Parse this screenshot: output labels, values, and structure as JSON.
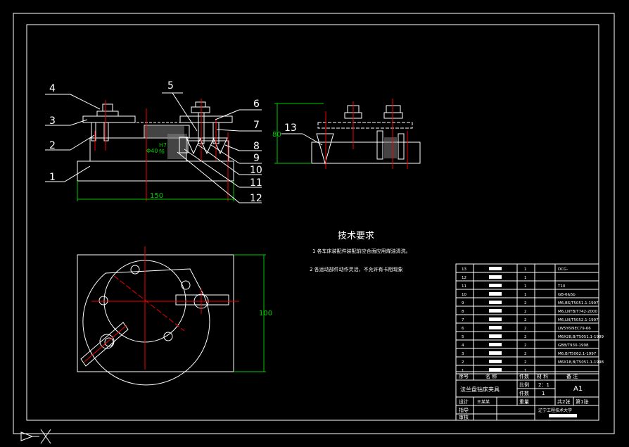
{
  "labels": {
    "view1": [
      "1",
      "2",
      "3",
      "4",
      "5",
      "6",
      "7",
      "8",
      "9",
      "10",
      "11",
      "12"
    ],
    "view2": "13"
  },
  "dims": {
    "width": "150",
    "height_side": "80",
    "height_top": "100",
    "fit_tol": "H7",
    "fit_dia": "Φ40",
    "fit_tol2": "f6"
  },
  "tech": {
    "title": "技术要求",
    "items": [
      "1  各车床装配件装配前应合面应用煤油清洗。",
      "2  各运动部件动作灵活，不允许有卡阻现象"
    ]
  },
  "bom": {
    "rows": [
      {
        "no": "13",
        "qty": "1",
        "std": "DCG-"
      },
      {
        "no": "12",
        "qty": "1",
        "std": ""
      },
      {
        "no": "11",
        "qty": "1",
        "std": "T10"
      },
      {
        "no": "10",
        "qty": "1",
        "std": "GB-6&5b"
      },
      {
        "no": "9",
        "qty": "2",
        "std": "M6,BS/T5051.1-1997"
      },
      {
        "no": "8",
        "qty": "2",
        "std": "M6,LNYB/T742-2000"
      },
      {
        "no": "7",
        "qty": "2",
        "std": "M6,LN/T5052.1-1997"
      },
      {
        "no": "6",
        "qty": "2",
        "std": "LW5Y6I9EC79-66"
      },
      {
        "no": "5",
        "qty": "2",
        "std": "M6X28,B/T5051.1-1999"
      },
      {
        "no": "4",
        "qty": "2",
        "std": "GBB/T930-1998"
      },
      {
        "no": "3",
        "qty": "2",
        "std": "M6,B/T5062.1-1997"
      },
      {
        "no": "2",
        "qty": "2",
        "std": "M6X18,B/T5051.1-1998"
      },
      {
        "no": "1",
        "qty": "1",
        "std": ""
      }
    ],
    "header": {
      "seq": "序号",
      "name": "名  称",
      "qty": "件数",
      "mat": "材  料",
      "note": "备  注"
    },
    "title_name": "法兰盘钻床夹具",
    "scale_label": "比例",
    "scale": "2：1",
    "count_label": "件数",
    "count": "1",
    "sheet": "A1",
    "design": "设计",
    "designer": "王某某",
    "check": "指导",
    "review": "审核",
    "weight": "重量",
    "total": "共2张",
    "page": "第1张",
    "school": "辽宁工程技术大学"
  }
}
